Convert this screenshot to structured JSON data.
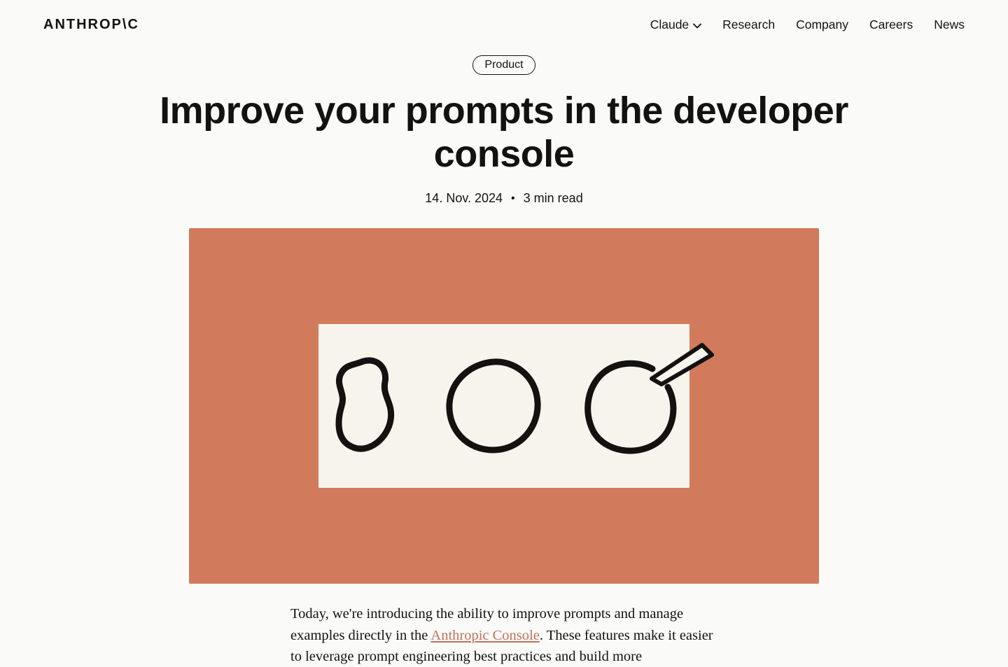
{
  "brand": "ANTHROP\\C",
  "nav": {
    "claude": "Claude",
    "research": "Research",
    "company": "Company",
    "careers": "Careers",
    "news": "News"
  },
  "article": {
    "category": "Product",
    "title": "Improve your prompts in the developer console",
    "date": "14. Nov. 2024",
    "read_time": "3 min read",
    "body_before_link": "Today, we're introducing the ability to improve prompts and manage examples directly in the ",
    "link_text": "Anthropic Console",
    "body_after_link": ". These features make it easier to leverage prompt engineering best practices and build more"
  }
}
